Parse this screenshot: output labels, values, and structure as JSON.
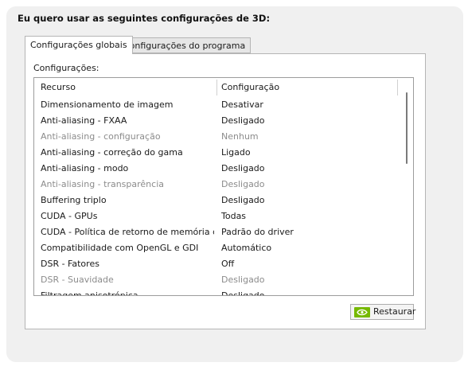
{
  "heading": "Eu quero usar as seguintes configurações de 3D:",
  "tabs": [
    {
      "label": "Configurações globais",
      "active": true
    },
    {
      "label": "Configurações do programa",
      "active": false
    }
  ],
  "settings_label": "Configurações:",
  "table": {
    "columns": [
      "Recurso",
      "Configuração"
    ],
    "rows": [
      {
        "resource": "Dimensionamento de imagem",
        "value": "Desativar",
        "disabled": false
      },
      {
        "resource": "Anti-aliasing - FXAA",
        "value": "Desligado",
        "disabled": false
      },
      {
        "resource": "Anti-aliasing - configuração",
        "value": "Nenhum",
        "disabled": true
      },
      {
        "resource": "Anti-aliasing - correção do gama",
        "value": "Ligado",
        "disabled": false
      },
      {
        "resource": "Anti-aliasing - modo",
        "value": "Desligado",
        "disabled": false
      },
      {
        "resource": "Anti-aliasing - transparência",
        "value": "Desligado",
        "disabled": true
      },
      {
        "resource": "Buffering triplo",
        "value": "Desligado",
        "disabled": false
      },
      {
        "resource": "CUDA - GPUs",
        "value": "Todas",
        "disabled": false
      },
      {
        "resource": "CUDA - Política de retorno de memória do ...",
        "value": "Padrão do driver",
        "disabled": false
      },
      {
        "resource": "Compatibilidade com OpenGL e GDI",
        "value": "Automático",
        "disabled": false
      },
      {
        "resource": "DSR - Fatores",
        "value": "Off",
        "disabled": false
      },
      {
        "resource": "DSR - Suavidade",
        "value": "Desligado",
        "disabled": true
      },
      {
        "resource": "Filtragem anisotrópica",
        "value": "Desligado",
        "disabled": false
      }
    ]
  },
  "restore_button": {
    "label": "Restaurar",
    "icon": "nvidia-logo-icon"
  },
  "colors": {
    "nvidia_green": "#76b900",
    "disabled_text": "#8c8c8c"
  }
}
